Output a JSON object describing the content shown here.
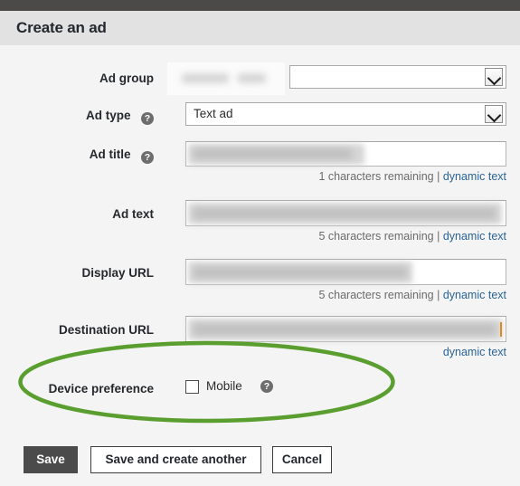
{
  "window": {
    "title": "Create an ad"
  },
  "form": {
    "rows": [
      {
        "label": "Ad group",
        "has_help": false,
        "control": "select",
        "value": "",
        "redacted_prefix": true,
        "helper": null
      },
      {
        "label": "Ad type",
        "has_help": true,
        "control": "select",
        "value": "Text ad",
        "options": [
          "Text ad"
        ],
        "helper": null
      },
      {
        "label": "Ad title",
        "has_help": true,
        "control": "text",
        "value": "",
        "helper": {
          "count": "1 characters remaining",
          "separator": "|",
          "link": "dynamic text"
        }
      },
      {
        "label": "Ad text",
        "has_help": false,
        "control": "text",
        "value": "",
        "helper": {
          "count": "5 characters remaining",
          "separator": "|",
          "link": "dynamic text"
        }
      },
      {
        "label": "Display URL",
        "has_help": false,
        "control": "text",
        "value": "",
        "helper": {
          "count": "5 characters remaining",
          "separator": "|",
          "link": "dynamic text"
        }
      },
      {
        "label": "Destination URL",
        "has_help": false,
        "control": "text",
        "value": "",
        "helper": {
          "count": "",
          "separator": "",
          "link": "dynamic text"
        }
      }
    ],
    "device_preference": {
      "label": "Device preference",
      "checkbox_label": "Mobile",
      "checked": false,
      "has_help": true
    },
    "help_icon_glyph": "?",
    "icons": {
      "help": "help-icon",
      "chevron": "chevron-down-icon"
    }
  },
  "actions": {
    "save": "Save",
    "save_and_create_another": "Save and create another",
    "cancel": "Cancel"
  },
  "annotation": {
    "shape": "ellipse",
    "color": "#5a9e2f",
    "target": "Device preference"
  },
  "colors": {
    "top_strip": "#4c4a48",
    "header_bg": "#e2e2e2",
    "body_bg": "#f4f4f4",
    "label_text": "#25282c",
    "link": "#2a6496",
    "helper_text": "#6b6b6b",
    "primary_button_bg": "#4b4b4b",
    "annotation_green": "#5a9e2f",
    "caret_orange": "#e08a1e"
  }
}
